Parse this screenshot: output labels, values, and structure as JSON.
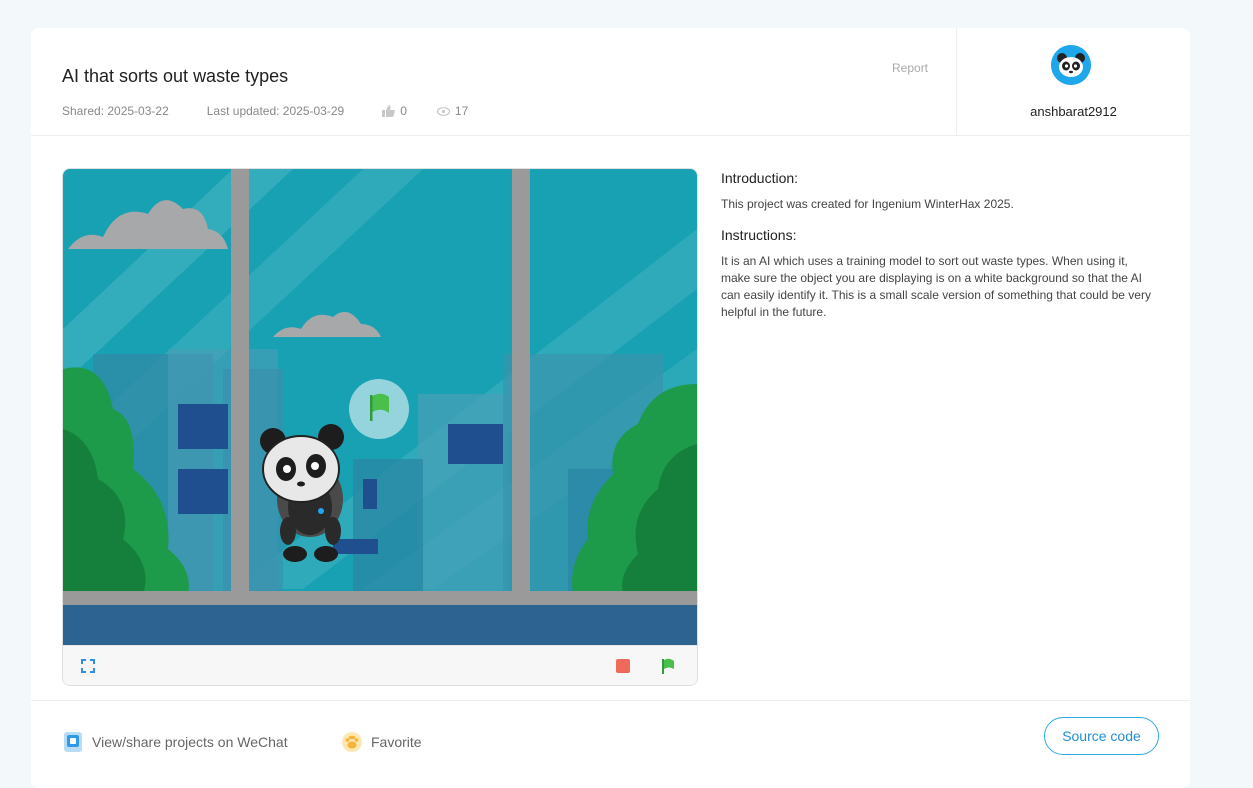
{
  "project": {
    "title": "AI that sorts out waste types",
    "shared": "Shared: 2025-03-22",
    "updated": "Last updated: 2025-03-29",
    "likes": "0",
    "views": "17",
    "report_label": "Report"
  },
  "author": {
    "username": "anshbarat2912"
  },
  "description": {
    "intro_heading": "Introduction:",
    "intro_text": "This project was created for Ingenium WinterHax 2025.",
    "instructions_heading": "Instructions:",
    "instructions_text": "It is an AI which uses a training model to sort out waste types. When using it, make sure the object you are displaying is on a white background so that the AI can easily identify it. This is a small scale version of something that could be very helpful in the future."
  },
  "footer": {
    "wechat_label": "View/share projects on WeChat",
    "favorite_label": "Favorite",
    "source_label": "Source code"
  },
  "colors": {
    "accent": "#2fa8e8",
    "stop": "#f06a5b",
    "flag": "#4bbf4b"
  }
}
